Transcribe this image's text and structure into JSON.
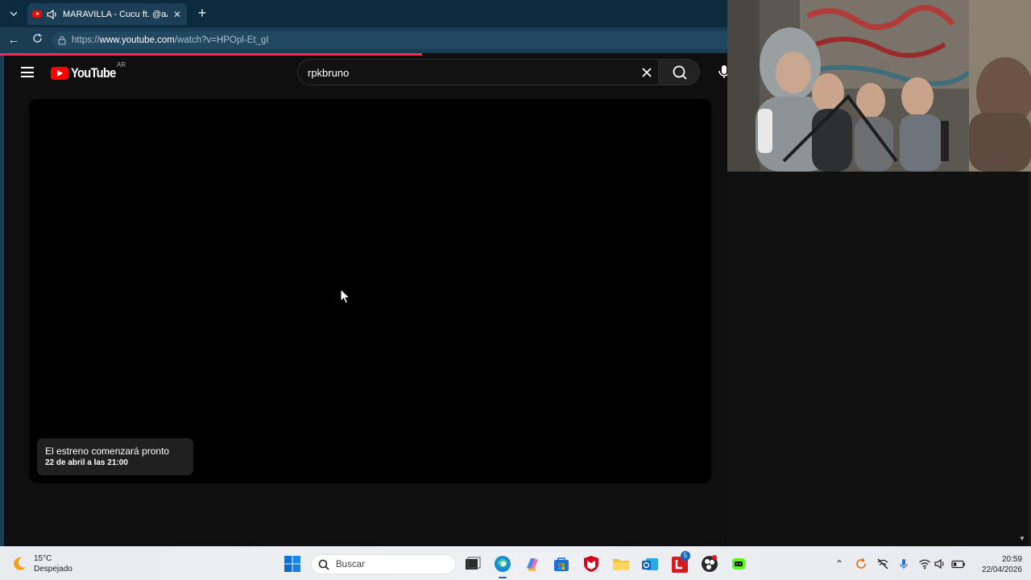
{
  "browser": {
    "tab": {
      "title": "MARAVILLA - Cucu ft. @aAlan",
      "favicon": "youtube-favicon",
      "audio_icon": "speaker-icon"
    },
    "new_tab_icon": "plus-icon",
    "tab_menu_icon": "chevron-down-icon",
    "address": {
      "prefix": "https://",
      "host": "www.youtube.com",
      "path": "/watch?v=HPOpl-Et_gI"
    },
    "load_progress": 0.58
  },
  "youtube": {
    "logo_text": "YouTube",
    "country_code": "AR",
    "search": {
      "value": "rpkbruno"
    },
    "premiere": {
      "message": "El estreno comenzará pronto",
      "date": "22 de abril a las 21:00"
    }
  },
  "taskbar": {
    "weather": {
      "temp": "15°C",
      "condition": "Despejado"
    },
    "search_placeholder": "Buscar",
    "clock": {
      "time": "20:59",
      "date": "22/04/2026"
    },
    "notification_badge": "5"
  },
  "colors": {
    "accent": "#ff0000",
    "page_bg": "#0f0f0f",
    "browser_chrome": "#1b3d53",
    "progress": "#ff2a5a"
  }
}
